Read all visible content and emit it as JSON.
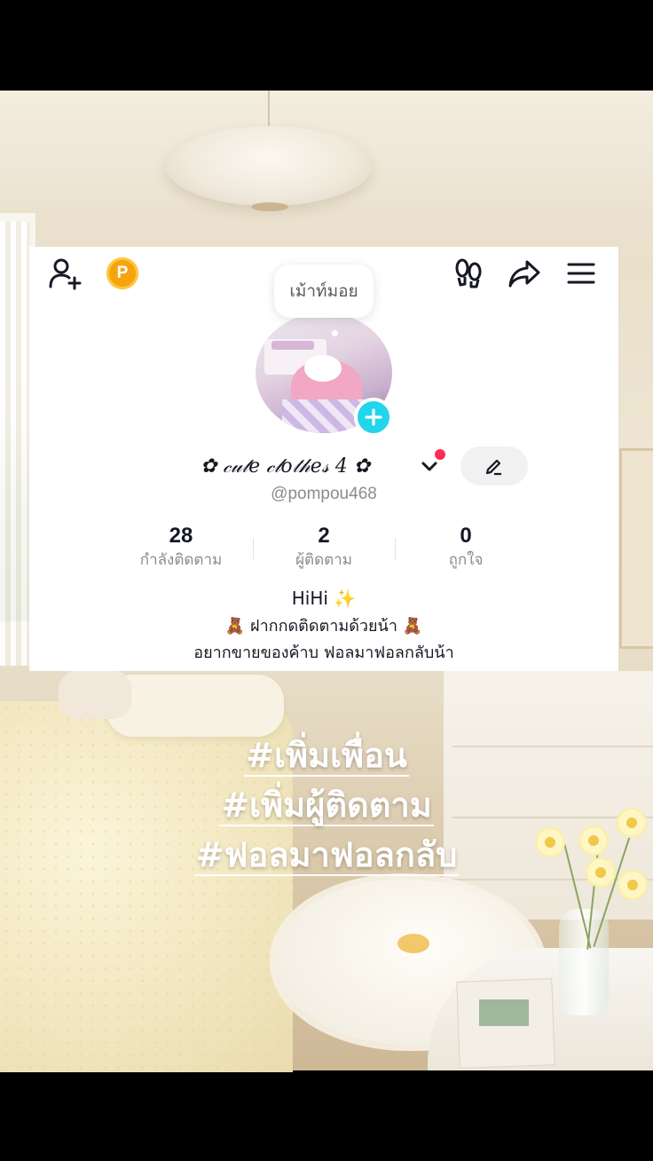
{
  "profile": {
    "avatar_bubble": "เม้าท์มอย",
    "display_name": "✿ 𝒸𝓊𝓉𝑒 𝒸𝓁𝑜𝓉𝒽𝑒𝓈 4 ✿",
    "username": "@pompou468",
    "coin_label": "P",
    "stats": [
      {
        "value": "28",
        "label": "กำลังติดตาม"
      },
      {
        "value": "2",
        "label": "ผู้ติดตาม"
      },
      {
        "value": "0",
        "label": "ถูกใจ"
      }
    ],
    "bio": [
      "HiHi ✨",
      "🧸 ฝากกดติดตามด้วยน้า 🧸",
      "อยากขายของค้าบ ฟอลมาฟอลกลับน้า"
    ]
  },
  "icons": {
    "add_friend": "add-user-icon",
    "coin": "coin-icon",
    "footprints": "footprints-icon",
    "share": "share-icon",
    "menu": "menu-icon",
    "plus": "plus-icon",
    "chevron": "chevron-down-icon",
    "edit": "pencil-icon"
  },
  "colors": {
    "accent_cyan": "#20d5ec",
    "notification_red": "#fe2c55",
    "coin_orange": "#f6a40e"
  },
  "hashtags": [
    "#เพิ่มเพื่อน",
    "#เพิ่มผู้ติดตาม",
    "#ฟอลมาฟอลกลับ"
  ]
}
